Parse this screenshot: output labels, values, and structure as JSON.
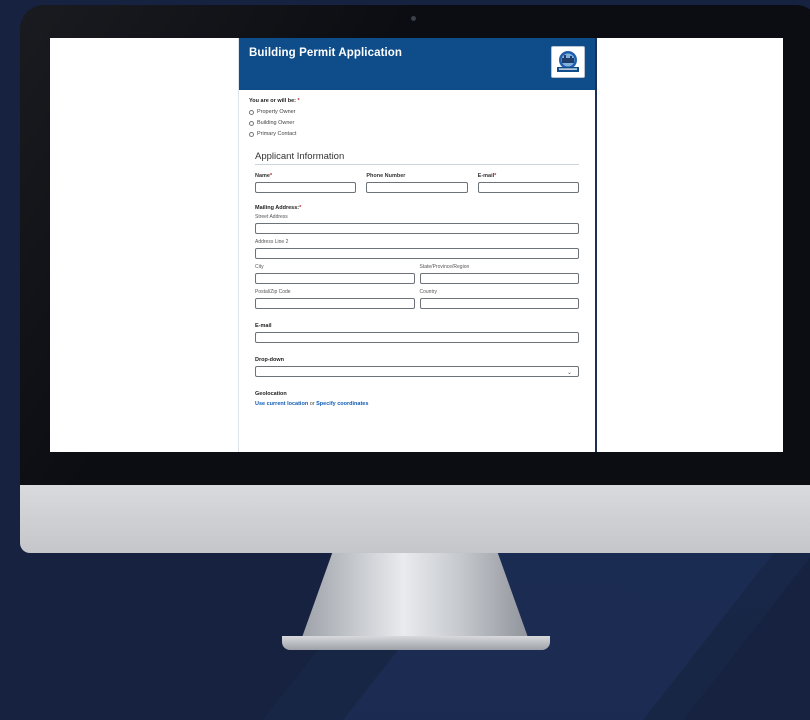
{
  "form": {
    "title": "Building Permit Application",
    "logo_name": "city-seal-icon",
    "role_question": "You are or will be:",
    "required_mark": "*",
    "role_options": [
      "Property Owner",
      "Building Owner",
      "Primary Contact"
    ],
    "applicant_section": "Applicant Information",
    "name_label": "Name",
    "phone_label": "Phone Number",
    "email_label": "E-mail",
    "mailing_label": "Mailing Address:",
    "street_label": "Street Address",
    "address2_label": "Address Line 2",
    "city_label": "City",
    "state_label": "State/Province/Region",
    "zip_label": "Postal/Zip Code",
    "country_label": "Country",
    "email2_label": "E-mail",
    "dropdown_label": "Drop-down",
    "dropdown_value": "",
    "geo_label": "Geolocation",
    "geo_current_link": "Use current location",
    "geo_or": "or",
    "geo_specify_link": "Specify coordinates"
  },
  "colors": {
    "header": "#0f4c8a",
    "link": "#0f5bb5",
    "background": "#16223f"
  }
}
